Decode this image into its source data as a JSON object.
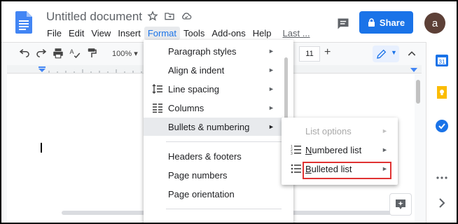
{
  "header": {
    "title": "Untitled document",
    "share_label": "Share",
    "avatar_initial": "a"
  },
  "menubar": {
    "items": [
      "File",
      "Edit",
      "View",
      "Insert",
      "Format",
      "Tools",
      "Add-ons",
      "Help",
      "Last ..."
    ],
    "active": "Format"
  },
  "toolbar": {
    "zoom": "100%",
    "font_size": "11",
    "minus": "-",
    "plus": "+"
  },
  "format_menu": {
    "items": [
      {
        "label": "Paragraph styles",
        "icon": "",
        "submenu": true
      },
      {
        "label": "Align & indent",
        "icon": "",
        "submenu": true
      },
      {
        "label": "Line spacing",
        "icon": "line-spacing-icon",
        "submenu": true
      },
      {
        "label": "Columns",
        "icon": "columns-icon",
        "submenu": true
      },
      {
        "label": "Bullets & numbering",
        "icon": "",
        "submenu": true,
        "hovered": true
      },
      {
        "label": "Headers & footers",
        "icon": "",
        "submenu": false
      },
      {
        "label": "Page numbers",
        "icon": "",
        "submenu": false
      },
      {
        "label": "Page orientation",
        "icon": "",
        "submenu": false
      }
    ],
    "arrow": "►"
  },
  "bullets_submenu": {
    "items": [
      {
        "label": "List options",
        "disabled": true
      },
      {
        "label": "Numbered list",
        "icon": "numbered-list-icon"
      },
      {
        "label": "Bulleted list",
        "icon": "bulleted-list-icon",
        "highlighted": true
      }
    ],
    "arrow": "►"
  },
  "colors": {
    "accent": "#1a73e8",
    "highlight_box": "#e03333",
    "avatar_bg": "#5d4037"
  }
}
